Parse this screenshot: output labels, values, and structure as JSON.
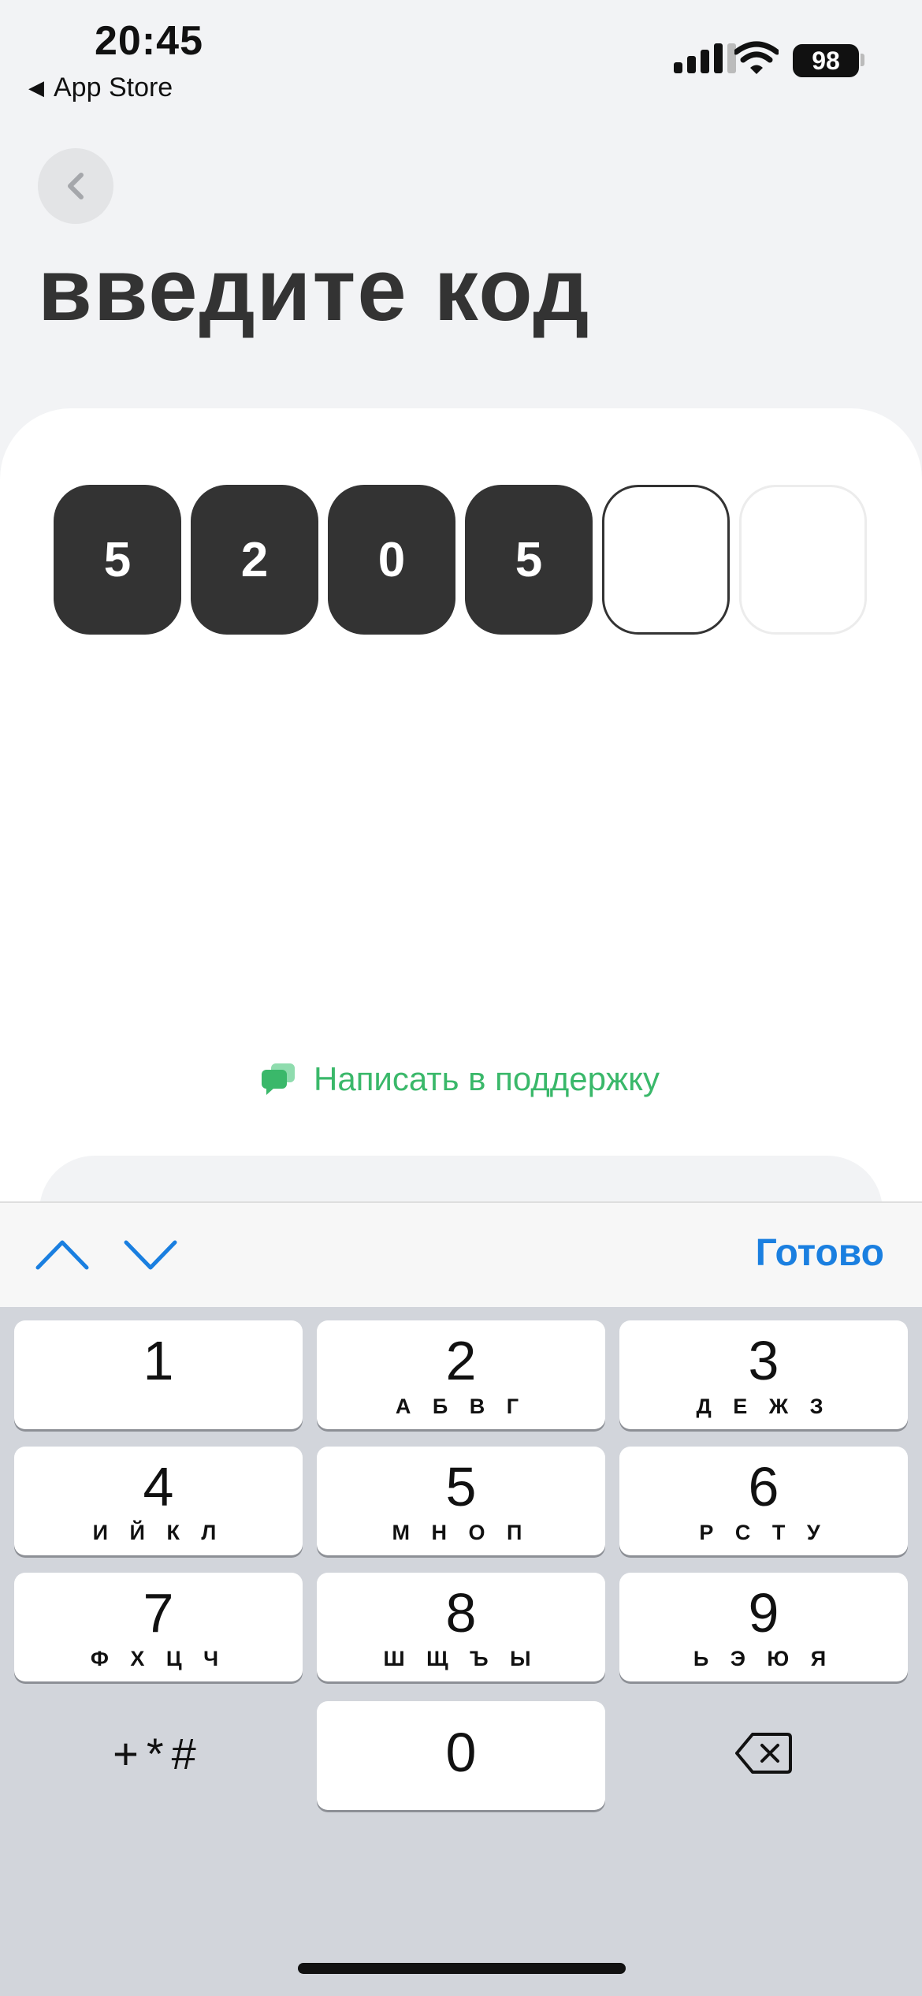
{
  "status_bar": {
    "time": "20:45",
    "back_app_label": "App Store",
    "battery_level": "98"
  },
  "header": {
    "back_icon": "chevron-left-icon",
    "title": "введите код"
  },
  "code_input": {
    "digits": [
      "5",
      "2",
      "0",
      "5",
      "",
      ""
    ],
    "length": 6
  },
  "support": {
    "icon": "chat-bubbles-icon",
    "label": "Написать в поддержку",
    "color": "#3ab86a"
  },
  "keyboard_toolbar": {
    "prev_icon": "chevron-up-icon",
    "next_icon": "chevron-down-icon",
    "done_label": "Готово",
    "done_color": "#1a7fe0"
  },
  "keypad": {
    "keys": [
      {
        "digit": "1",
        "letters": ""
      },
      {
        "digit": "2",
        "letters": "А Б В Г"
      },
      {
        "digit": "3",
        "letters": "Д Е Ж З"
      },
      {
        "digit": "4",
        "letters": "И Й К Л"
      },
      {
        "digit": "5",
        "letters": "М Н О П"
      },
      {
        "digit": "6",
        "letters": "Р С Т У"
      },
      {
        "digit": "7",
        "letters": "Ф Х Ц Ч"
      },
      {
        "digit": "8",
        "letters": "Ш Щ Ъ Ы"
      },
      {
        "digit": "9",
        "letters": "Ь Э Ю Я"
      },
      {
        "digit": "0",
        "letters": ""
      }
    ],
    "symbols_label": "+*#",
    "delete_icon": "backspace-icon"
  }
}
